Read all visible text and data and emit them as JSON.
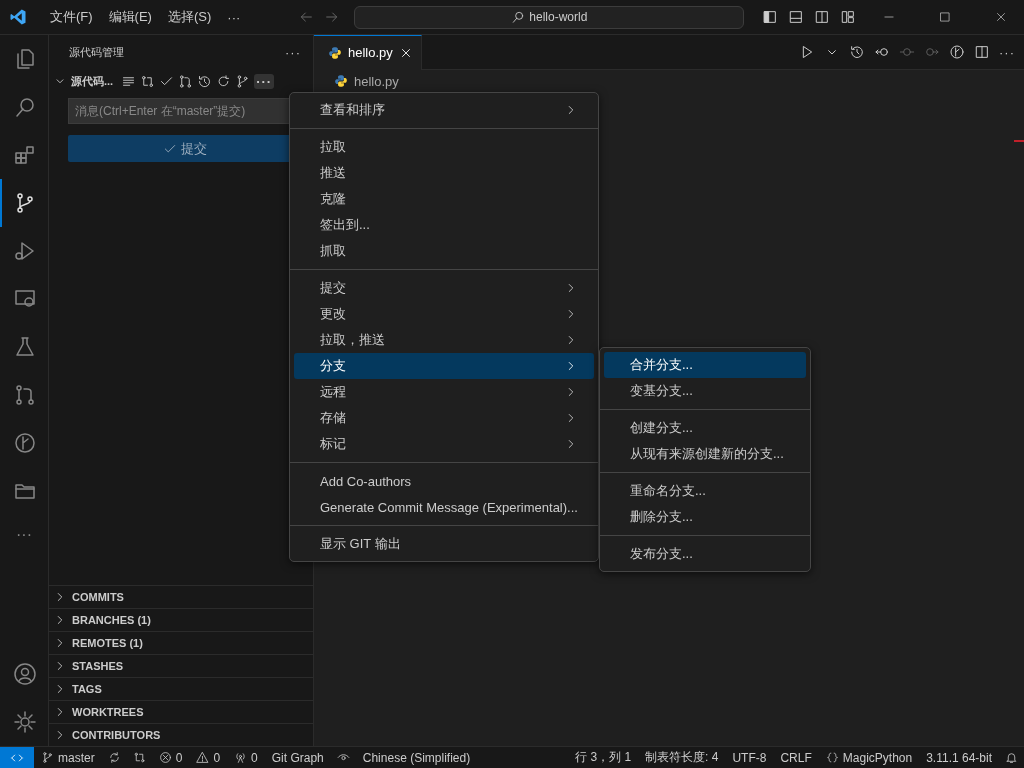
{
  "title_bar": {
    "menus": [
      "文件(F)",
      "编辑(E)",
      "选择(S)",
      "···"
    ],
    "search": "hello-world"
  },
  "activity_bar": {
    "items": [
      {
        "selected": false
      },
      {
        "selected": false
      },
      {
        "selected": false
      },
      {
        "selected": true
      },
      {
        "selected": false
      },
      {
        "selected": false
      },
      {
        "selected": false
      },
      {
        "selected": false
      },
      {
        "selected": false
      },
      {
        "selected": false
      }
    ],
    "more": "···",
    "bottom": [
      {
        "selected": false
      },
      {
        "selected": false
      }
    ]
  },
  "sidebar": {
    "title": "源代码管理",
    "more": "···",
    "section": {
      "title": "源代码...",
      "expanded": true,
      "more": "···"
    },
    "message_placeholder": "消息(Ctrl+Enter 在“master”提交)",
    "commit_button": "提交",
    "panels": [
      {
        "label": "COMMITS",
        "expanded": false
      },
      {
        "label": "BRANCHES (1)",
        "expanded": false
      },
      {
        "label": "REMOTES (1)",
        "expanded": false
      },
      {
        "label": "STASHES",
        "expanded": false
      },
      {
        "label": "TAGS",
        "expanded": false
      },
      {
        "label": "WORKTREES",
        "expanded": false
      },
      {
        "label": "CONTRIBUTORS",
        "expanded": false
      }
    ]
  },
  "editor": {
    "tabs": [
      {
        "label": "hello.py",
        "selected": true
      }
    ],
    "breadcrumb": "hello.py",
    "toolbar": [
      {
        "disabled": false
      },
      {
        "disabled": false
      },
      {
        "disabled": false
      },
      {
        "disabled": false
      },
      {
        "disabled": true
      },
      {
        "disabled": true
      },
      {
        "disabled": false
      },
      {
        "disabled": false
      }
    ],
    "more": "···"
  },
  "context_menu": {
    "groups": [
      [
        {
          "label": "查看和排序",
          "submenu": true,
          "selected": false
        }
      ],
      [
        {
          "label": "拉取",
          "submenu": false,
          "selected": false
        },
        {
          "label": "推送",
          "submenu": false,
          "selected": false
        },
        {
          "label": "克隆",
          "submenu": false,
          "selected": false
        },
        {
          "label": "签出到...",
          "submenu": false,
          "selected": false
        },
        {
          "label": "抓取",
          "submenu": false,
          "selected": false
        }
      ],
      [
        {
          "label": "提交",
          "submenu": true,
          "selected": false
        },
        {
          "label": "更改",
          "submenu": true,
          "selected": false
        },
        {
          "label": "拉取，推送",
          "submenu": true,
          "selected": false
        },
        {
          "label": "分支",
          "submenu": true,
          "selected": true
        },
        {
          "label": "远程",
          "submenu": true,
          "selected": false
        },
        {
          "label": "存储",
          "submenu": true,
          "selected": false
        },
        {
          "label": "标记",
          "submenu": true,
          "selected": false
        }
      ],
      [
        {
          "label": "Add Co-authors",
          "submenu": false,
          "selected": false
        },
        {
          "label": "Generate Commit Message (Experimental)...",
          "submenu": false,
          "selected": false
        }
      ],
      [
        {
          "label": "显示 GIT 输出",
          "submenu": false,
          "selected": false
        }
      ]
    ]
  },
  "submenu": {
    "groups": [
      [
        {
          "label": "合并分支...",
          "selected": true
        },
        {
          "label": "变基分支...",
          "selected": false
        }
      ],
      [
        {
          "label": "创建分支...",
          "selected": false
        },
        {
          "label": "从现有来源创建新的分支...",
          "selected": false
        }
      ],
      [
        {
          "label": "重命名分支...",
          "selected": false
        },
        {
          "label": "删除分支...",
          "selected": false
        }
      ],
      [
        {
          "label": "发布分支...",
          "selected": false
        }
      ]
    ]
  },
  "status_bar": {
    "branch": "master",
    "errors": "0",
    "warnings": "0",
    "ports": "0",
    "git_graph": "Git Graph",
    "language_pack": "Chinese (Simplified)",
    "position": "行 3，列 1",
    "tab_size": "制表符长度: 4",
    "encoding": "UTF-8",
    "line_ending": "CRLF",
    "language": "MagicPython",
    "interpreter": "3.11.1 64-bit"
  }
}
